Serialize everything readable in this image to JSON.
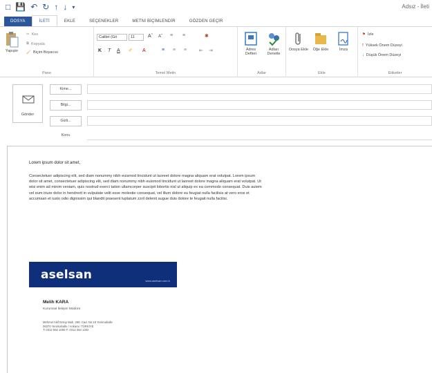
{
  "window": {
    "title": "Adsız - İleti"
  },
  "tabs": [
    {
      "label": "DOSYA"
    },
    {
      "label": "İLETİ"
    },
    {
      "label": "EKLE"
    },
    {
      "label": "SEÇENEKLER"
    },
    {
      "label": "METNİ BİÇİMLENDİR"
    },
    {
      "label": "GÖZDEN GEÇİR"
    }
  ],
  "ribbon": {
    "clipboard": {
      "paste": "Yapıştır",
      "cut": "Kes",
      "copy": "Kopyala",
      "format_painter": "Biçim Boyacısı",
      "group_label": "Pano"
    },
    "basic_text": {
      "font_name": "Calibri (Gö",
      "font_size": "11",
      "bold": "K",
      "italic": "T",
      "underline": "A",
      "group_label": "Temel Metin"
    },
    "names": {
      "address_book": "Adres Defteri",
      "check_names": "Adları Denetle",
      "group_label": "Adlar"
    },
    "include": {
      "attach_file": "Dosya Ekle",
      "attach_item": "Öğe Ekle",
      "signature": "İmza",
      "group_label": "Ekle"
    },
    "tags": {
      "follow_up": "İzle",
      "high_importance": "Yüksek Önem Düzeyi",
      "low_importance": "Düşük Önem Düzeyi",
      "group_label": "Etiketler"
    }
  },
  "compose": {
    "send": "Gönder",
    "to": "Kime...",
    "cc": "Bilgi...",
    "bcc": "Gizli...",
    "subject": "Konu",
    "to_value": "",
    "cc_value": "",
    "bcc_value": "",
    "subject_value": ""
  },
  "message": {
    "greeting": "Lorem ipsum dolor sit amet,",
    "paragraph": "Consectetuer adipiscing elit, sed diam nonummy nibh euismod tincidunt ut laoreet dolore magna aliquam erat volutpat. Lorem ipsum dolor sit amet, consectetuer adipiscing elit, sed diam nonummy nibh euismod tincidunt ut laoreet dolore magna aliquam erat volutpat. Ut wisi enim ad minim veniam, quis nostrud exerci tation ullamcorper suscipit lobortis nisl ut aliquip ex ea commodo consequat. Duis autem vel eum iriure dolor in hendrerit in vulputate velit esse molestie consequat, vel illum dolore eu feugiat nulla facilisis at vero eros et accumsan et iusto odio dignissim qui blandit praesent luptatum zzril delenit augue duis dolore te feugait nulla facilisi."
  },
  "signature": {
    "brand": "aselsan",
    "url": "www.aselsan.com.tr",
    "name": "Melih KARA",
    "title": "Kurumsal İletişim Müdürü",
    "address_line1": "Mehmet Akif Ersoy Mah. 296. Cad. No:16 Yenimahalle",
    "address_line2": "06370 Yenimahalle / Ankara / TÜRKİYE",
    "phone": "T: 0312 592 1000  F: 0312 354 1302"
  },
  "colors": {
    "file_tab": "#2b579a",
    "brand_banner": "#0f2f7a"
  }
}
